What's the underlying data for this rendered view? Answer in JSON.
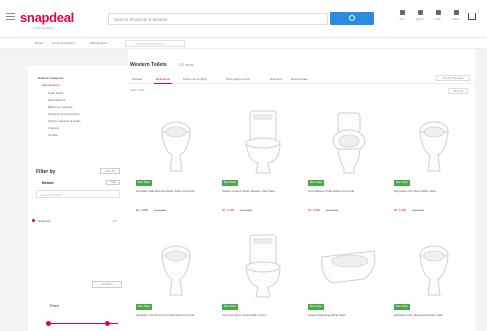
{
  "header": {
    "logo": "snapdeal",
    "logo_sub": "Unbox Zindagi",
    "search_placeholder": "Search Products & Brands",
    "search_button": "Search",
    "icons": [
      {
        "name": "cart-icon",
        "label": "Cart"
      },
      {
        "name": "user-icon",
        "label": "Sign In"
      },
      {
        "name": "help-icon",
        "label": "Help"
      },
      {
        "name": "offers-icon",
        "label": "Offers"
      }
    ]
  },
  "breadcrumb": {
    "items": [
      "Home",
      "Home Furnishing",
      "Sanitaryware"
    ],
    "search_placeholder": "Search in this category"
  },
  "sidebar": {
    "categories": [
      {
        "label": "Related Categories",
        "type": "head"
      },
      {
        "label": "Sanitaryware",
        "type": "active"
      },
      {
        "label": "Toilet Seats",
        "type": "normal"
      },
      {
        "label": "Wash Basins",
        "type": "normal"
      },
      {
        "label": "Bathroom Faucets",
        "type": "normal"
      },
      {
        "label": "Showers & Accessories",
        "type": "normal"
      },
      {
        "label": "Kitchen Faucets & Sinks",
        "type": "normal"
      },
      {
        "label": "Cisterns",
        "type": "normal"
      },
      {
        "label": "Urinals",
        "type": "normal"
      }
    ],
    "filter_title": "Filter by",
    "clear_label": "Clear All",
    "brand_title": "Brand",
    "brand_tag": "Clear",
    "brand_search_placeholder": "Search by Brand",
    "brand_option": "Hindware",
    "brand_option_count": "(48)",
    "show_more": "View More",
    "price_title": "Price",
    "price_range": {
      "min": 0.0,
      "max": 0.85
    }
  },
  "main": {
    "title": "Western Toilets",
    "count": "123 Items",
    "tabs": [
      "Popular",
      "Relevance",
      "Price Low to High",
      "Price High to Low",
      "Discount",
      "New Arrivals"
    ],
    "active_tab": 1,
    "sort_label": "Sort by: Popularity",
    "view_label": "View: Grid",
    "view_toggle": "Show 20",
    "products": [
      {
        "tag": "Best Seller",
        "name": "Hindware Wall Mounted White Toilet Commode",
        "price": "Rs. 4,899",
        "mrp": "Rs. 6,599",
        "shape": "floor"
      },
      {
        "tag": "Best Seller",
        "name": "Jaquar Ceramic White Western Toilet Seat",
        "price": "Rs. 5,199",
        "mrp": "Rs. 7,299",
        "shape": "tank"
      },
      {
        "tag": "Best Seller",
        "name": "Cera Western Toilet White Commode",
        "price": "Rs. 3,999",
        "mrp": "Rs. 5,499",
        "shape": "seat"
      },
      {
        "tag": "Best Seller",
        "name": "Parryware One Piece White Toilet",
        "price": "Rs. 6,499",
        "mrp": "Rs. 8,999",
        "shape": "floor"
      },
      {
        "tag": "Best Seller",
        "name": "Hindware One Piece Floor Mounted Commode",
        "price": "Rs. 7,299",
        "mrp": "Rs. 9,999",
        "shape": "floor"
      },
      {
        "tag": "Best Seller",
        "name": "Cera Two Piece Closet With Cistern",
        "price": "Rs. 4,599",
        "mrp": "Rs. 6,199",
        "shape": "tank"
      },
      {
        "tag": "Best Seller",
        "name": "Jaquar Wall Hung White Toilet",
        "price": "Rs. 5,899",
        "mrp": "Rs. 7,999",
        "shape": "wall"
      },
      {
        "tag": "Best Seller",
        "name": "Hindware Floor Mounted Western Toilet",
        "price": "Rs. 6,799",
        "mrp": "Rs. 8,499",
        "shape": "floor"
      }
    ]
  }
}
